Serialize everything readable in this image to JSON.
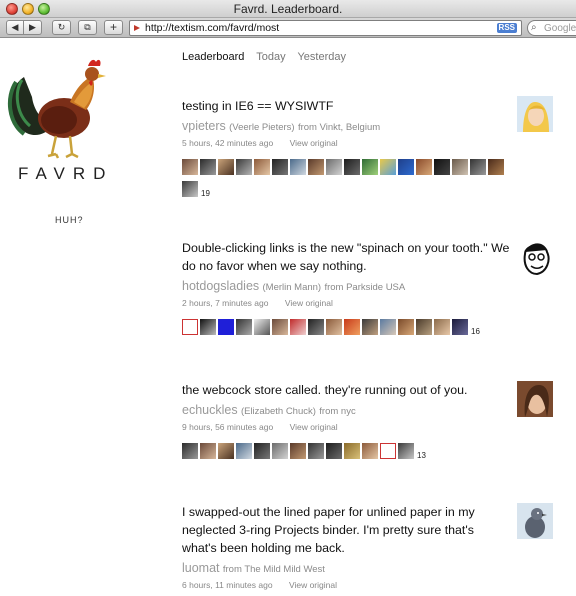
{
  "window": {
    "title": "Favrd. Leaderboard."
  },
  "toolbar": {
    "back": "◀",
    "forward": "▶",
    "reload": "↻",
    "snap": "⧉",
    "addtab": "+",
    "url": "http://textism.com/favrd/most",
    "rss": "RSS",
    "search_placeholder": "Google"
  },
  "sidebar": {
    "brand": "FAVRD",
    "huh": "HUH?"
  },
  "nav": {
    "tabs": [
      "Leaderboard",
      "Today",
      "Yesterday"
    ],
    "active": 0
  },
  "entries": [
    {
      "quote": "testing in IE6 == WYSIWTF",
      "user": "vpieters",
      "fullname": "(Veerle Pieters)",
      "location": "from Vinkt, Belgium",
      "time": "5 hours, 42 minutes ago",
      "view": "View original",
      "count": "19",
      "avatar_colors": [
        "#f3c84a",
        "#d9e7f3"
      ]
    },
    {
      "quote": "Double-clicking links is the new \"spinach on your tooth.\" We do no favor when we say nothing.",
      "user": "hotdogsladies",
      "fullname": "(Merlin Mann)",
      "location": "from Parkside USA",
      "time": "2 hours, 7 minutes ago",
      "view": "View original",
      "count": "16",
      "avatar_colors": [
        "#ffffff",
        "#111111"
      ]
    },
    {
      "quote": "the webcock store called. they're running out of you.",
      "user": "echuckles",
      "fullname": "(Elizabeth Chuck)",
      "location": "from nyc",
      "time": "9 hours, 56 minutes ago",
      "view": "View original",
      "count": "13",
      "avatar_colors": [
        "#7a4a2e",
        "#c9a27a"
      ]
    },
    {
      "quote": "I swapped-out the lined paper for unlined paper in my neglected 3-ring Projects binder. I'm pretty sure that's what's been holding me back.",
      "user": "luomat",
      "fullname": "",
      "location": "from The Mild Mild West",
      "time": "6 hours, 11 minutes ago",
      "view": "View original",
      "count": "",
      "avatar_colors": [
        "#d8e4ee",
        "#5a6270"
      ]
    }
  ],
  "theme": {
    "empty_fav_border": "#cc3333",
    "muted_text": "#8a8a8a"
  }
}
